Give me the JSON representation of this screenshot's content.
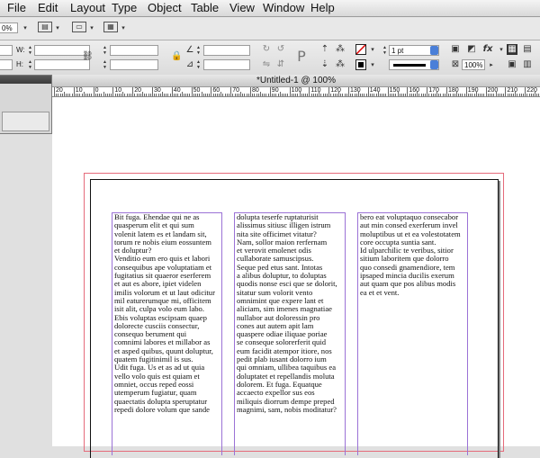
{
  "menu": [
    "File",
    "Edit",
    "Layout",
    "Type",
    "Object",
    "Table",
    "View",
    "Window",
    "Help"
  ],
  "toolbar": {
    "zoom_value": "0%",
    "w_label": "W:",
    "h_label": "H:",
    "stroke_weight": "1 pt",
    "percent": "100%"
  },
  "document": {
    "title": "*Untitled-1 @ 100%"
  },
  "ruler": {
    "numbers": [
      "20",
      "10",
      "0",
      "10",
      "20",
      "30",
      "40",
      "50",
      "60",
      "70",
      "80",
      "90",
      "100",
      "110",
      "120",
      "130",
      "140",
      "150",
      "160",
      "170",
      "180",
      "190",
      "200",
      "210",
      "220"
    ]
  },
  "columns": [
    {
      "lines": [
        "Bit fuga. Ehendae qui ne as",
        "quasperum elit et qui sum",
        "volenit latem es et landam sit,",
        "torum re nobis eium eossuntem",
        "et doluptur?",
        "Venditio eum ero quis et labori",
        "consequibus ape voluptatiam et",
        "fugitatius sit quaeror eserferem",
        "et aut es abore, ipiet videlen",
        "imilis volorum et ut laut odicitur",
        "mil eaturerumque mi, officitem",
        "isit alit, culpa volo eum labo.",
        "Ebis voluptas escipsam quaep",
        "dolorecte cusciis consectur,",
        "consequo berument qui",
        "comnimi labores et millabor as",
        "et asped quibus, quunt doluptur,",
        "quatem fugitinimil is sus.",
        "Udit fuga. Us et as ad ut quia",
        "vello volo quis est quiam et",
        "omniet, occus reped eossi",
        "utemperum fugiatur, quam",
        "quaectatis dolupta speruptatur",
        "repedi dolore volum que sande"
      ]
    },
    {
      "lines": [
        "dolupta teserfe ruptaturisit",
        "alissimus sitiusc illigen istrum",
        "nita site officimet vitatur?",
        "Nam, sollor maion rerfernam",
        "et verovit emolenet odis",
        "cullaborate samuscipsus.",
        "Seque ped etus sant. Intotas",
        "a alibus doluptur, to doluptas",
        "quodis nonse esci que se dolorit,",
        "sitatur sum volorit vento",
        "omnimint que expere lant et",
        "aliciam, sim imenes magnatiae",
        "nullabor aut doloressin pro",
        "cones aut autem apit lam",
        "quaspere odiae iliquae poriae",
        "se conseque solorerferit quid",
        "eum facidit atempor itiore, nos",
        "pedit plab iusant dolorro ium",
        "qui omniam, ullibea taquibus ea",
        "doluptatet et repellandis moluta",
        "dolorem. Et fuga. Equatque",
        "accaecto expellor sus eos",
        "miliquis diorrum dempe preped",
        "magnimi, sam, nobis moditatur?"
      ]
    },
    {
      "lines": [
        "bero eat voluptaquo consecabor",
        "aut min consed exerferum invel",
        "moluptibus ut et ea volestotatem",
        "core occupta suntia sant.",
        "Id ulparchilic te veribus, sitior",
        "sitium laboritem que dolorro",
        "quo consedi gnamendiore, tem",
        "ipsaped mincia ducilis exerum",
        "aut quam que pos alibus modis",
        "ea et et vent."
      ]
    }
  ]
}
